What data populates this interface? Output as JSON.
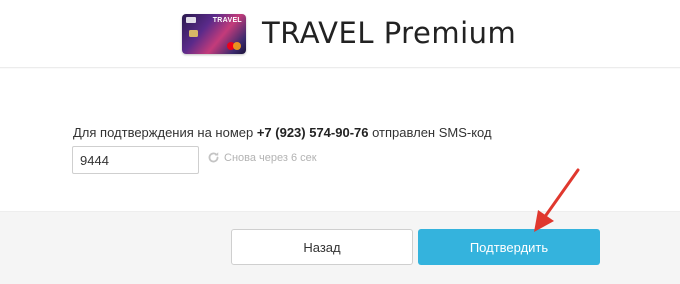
{
  "header": {
    "title": "TRAVEL Premium",
    "card_word": "TRAVEL"
  },
  "sms": {
    "prefix": "Для подтверждения на номер ",
    "phone": "+7 (923) 574-90-76",
    "suffix": " отправлен SMS-код",
    "code_value": "9444",
    "resend_label": "Снова через 6 сек"
  },
  "buttons": {
    "back_label": "Назад",
    "confirm_label": "Подтвердить"
  },
  "colors": {
    "accent": "#34b3dd",
    "annotation_arrow": "#e0382e"
  },
  "icons": {
    "resend": "refresh-icon",
    "annotation": "red-arrow-annotation"
  }
}
